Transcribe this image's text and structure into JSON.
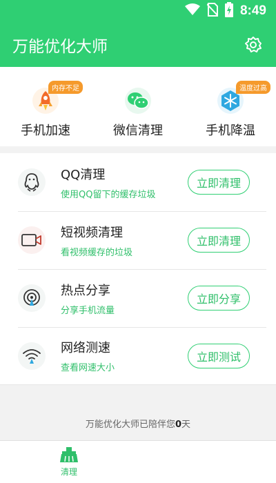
{
  "status_bar": {
    "time": "8:49"
  },
  "app": {
    "title": "万能优化大师"
  },
  "quick_actions": [
    {
      "label": "手机加速",
      "badge": "内存不足",
      "icon": "rocket-icon"
    },
    {
      "label": "微信清理",
      "badge": "",
      "icon": "wechat-icon"
    },
    {
      "label": "手机降温",
      "badge": "温度过高",
      "icon": "snowflake-icon"
    }
  ],
  "list": [
    {
      "title": "QQ清理",
      "subtitle": "使用QQ留下的缓存垃圾",
      "button": "立即清理",
      "icon": "qq-icon"
    },
    {
      "title": "短视频清理",
      "subtitle": "看视频缓存的垃圾",
      "button": "立即清理",
      "icon": "video-camera-icon"
    },
    {
      "title": "热点分享",
      "subtitle": "分享手机流量",
      "button": "立即分享",
      "icon": "hotspot-icon"
    },
    {
      "title": "网络测速",
      "subtitle": "查看网速大小",
      "button": "立即测试",
      "icon": "wifi-icon"
    }
  ],
  "footer": {
    "prefix": "万能优化大师已陪伴您",
    "days": "0",
    "suffix": "天"
  },
  "tabs": [
    {
      "label": "清理",
      "icon": "broom-icon"
    }
  ],
  "colors": {
    "primary": "#2fcf73",
    "accent_text": "#2fbf6a",
    "badge": "#f59a2c"
  }
}
